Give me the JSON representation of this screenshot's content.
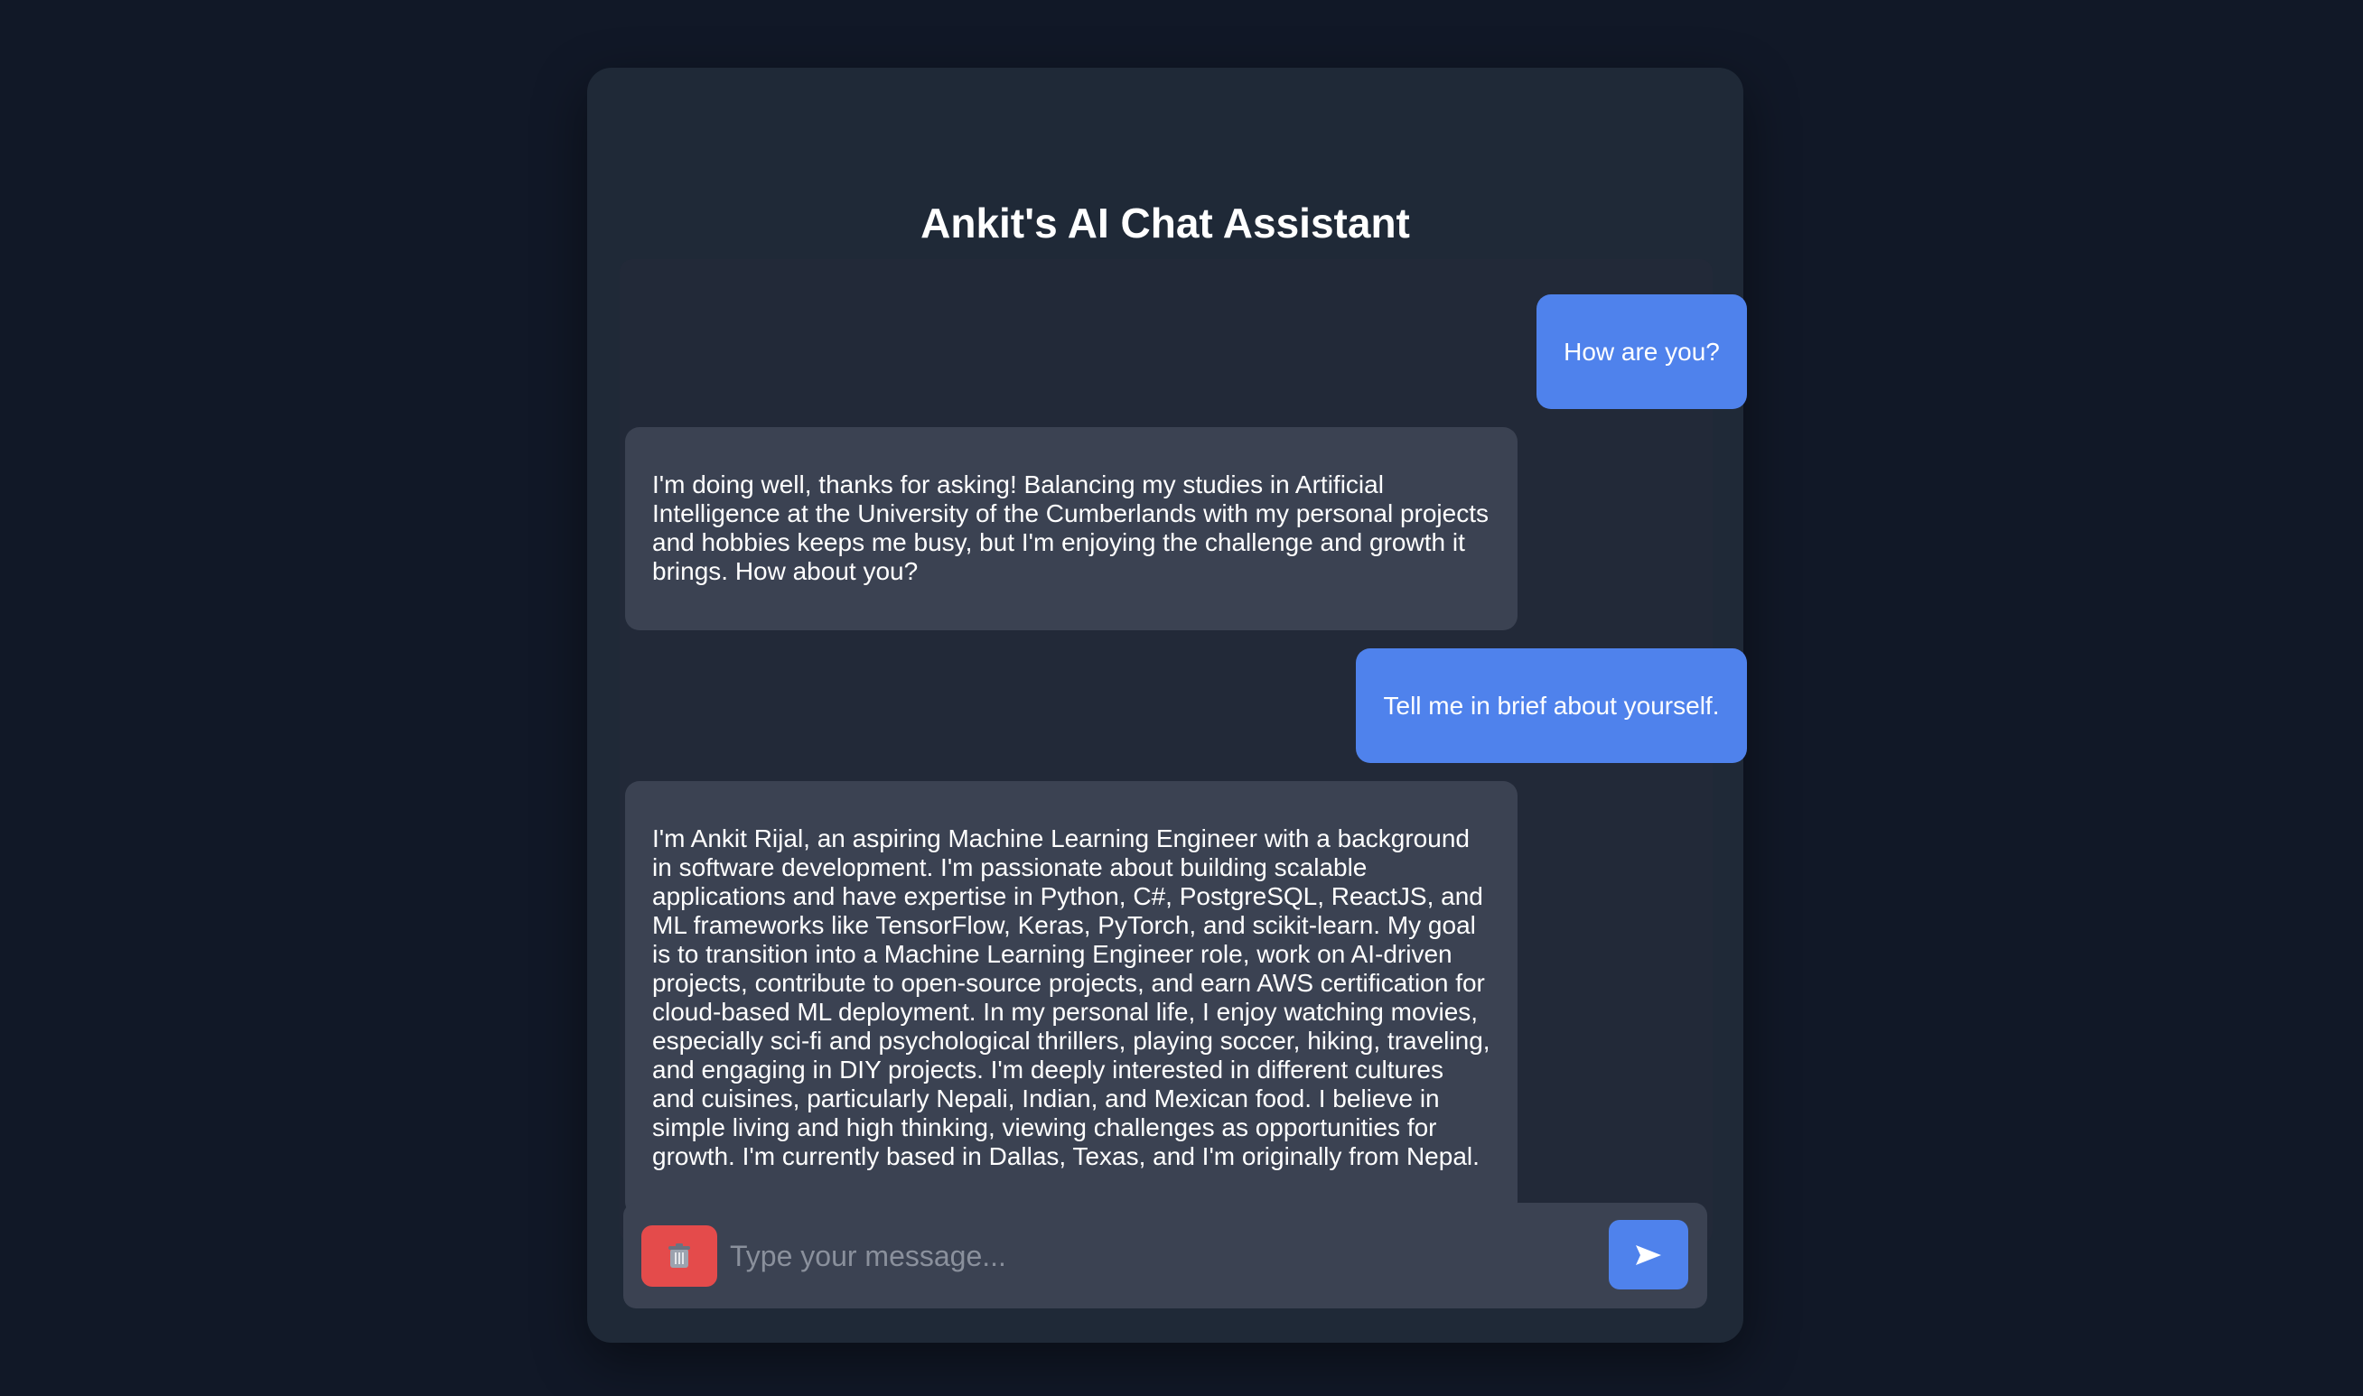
{
  "app": {
    "title": "Ankit's AI Chat Assistant"
  },
  "messages": [
    {
      "role": "user",
      "text": "How are you?"
    },
    {
      "role": "assistant",
      "text": "I'm doing well, thanks for asking! Balancing my studies in Artificial Intelligence at the University of the Cumberlands with my personal projects and hobbies keeps me busy, but I'm enjoying the challenge and growth it brings. How about you?"
    },
    {
      "role": "user",
      "text": "Tell me in brief about yourself."
    },
    {
      "role": "assistant",
      "text": "I'm Ankit Rijal, an aspiring Machine Learning Engineer with a background in software development. I'm passionate about building scalable applications and have expertise in Python, C#, PostgreSQL, ReactJS, and ML frameworks like TensorFlow, Keras, PyTorch, and scikit-learn. My goal is to transition into a Machine Learning Engineer role, work on AI-driven projects, contribute to open-source projects, and earn AWS certification for cloud-based ML deployment. In my personal life, I enjoy watching movies, especially sci-fi and psychological thrillers, playing soccer, hiking, traveling, and engaging in DIY projects. I'm deeply interested in different cultures and cuisines, particularly Nepali, Indian, and Mexican food. I believe in simple living and high thinking, viewing challenges as opportunities for growth. I'm currently based in Dallas, Texas, and I'm originally from Nepal."
    }
  ],
  "composer": {
    "placeholder": "Type your message...",
    "value": "",
    "clear_icon": "trash-icon",
    "send_icon": "send-arrow-icon"
  },
  "colors": {
    "page_background": "#111827",
    "card_background": "#1f2937",
    "user_bubble": "#4f82ec",
    "assistant_bubble": "#3b4252",
    "clear_button": "#e44b4b",
    "send_button": "#4f82ec"
  }
}
